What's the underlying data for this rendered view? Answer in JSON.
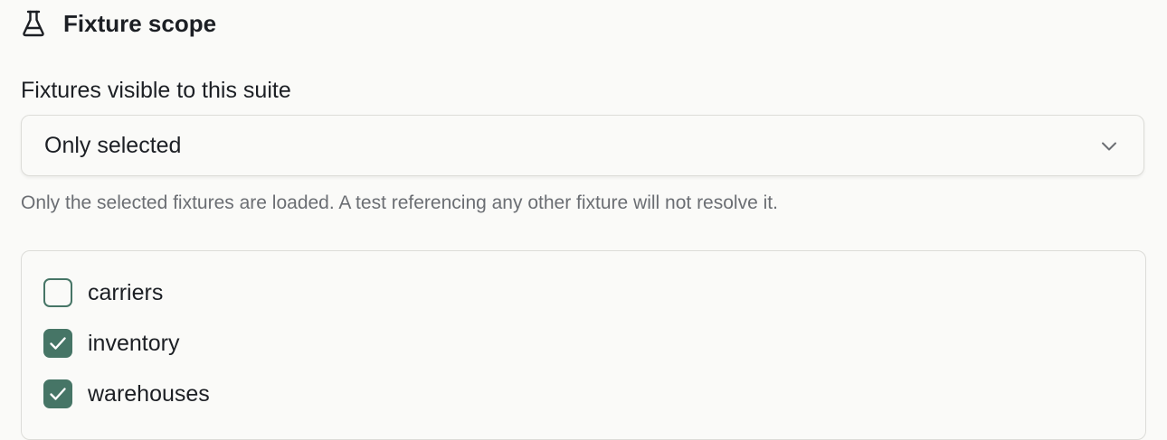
{
  "section": {
    "title": "Fixture scope",
    "icon": "flask-icon"
  },
  "scope_select": {
    "label": "Fixtures visible to this suite",
    "value": "Only selected",
    "icon": "chevron-down-icon",
    "help": "Only the selected fixtures are loaded. A test referencing any other fixture will not resolve it."
  },
  "fixtures": [
    {
      "label": "carriers",
      "checked": false
    },
    {
      "label": "inventory",
      "checked": true
    },
    {
      "label": "warehouses",
      "checked": true
    }
  ],
  "colors": {
    "accent": "#467566",
    "text": "#1c1f24",
    "muted_text": "#6b6e73",
    "border": "#dcdcd8",
    "background": "#fafaf8"
  }
}
